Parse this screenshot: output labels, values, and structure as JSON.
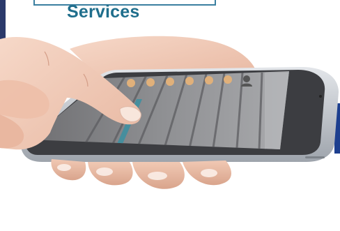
{
  "header": {
    "title": "Services"
  },
  "phone": {
    "screen_columns": [
      "",
      "",
      "",
      "",
      "",
      "",
      "",
      ""
    ],
    "accent_color": "#3f8fa0",
    "avatar_icon": "user-avatar-icon"
  },
  "colors": {
    "heading": "#1f6e8c",
    "left_bar": "#2b3a6b",
    "right_tab": "#1d3f8f",
    "skin": "#f3cdbb",
    "phone_body": "#c8cdd3"
  }
}
